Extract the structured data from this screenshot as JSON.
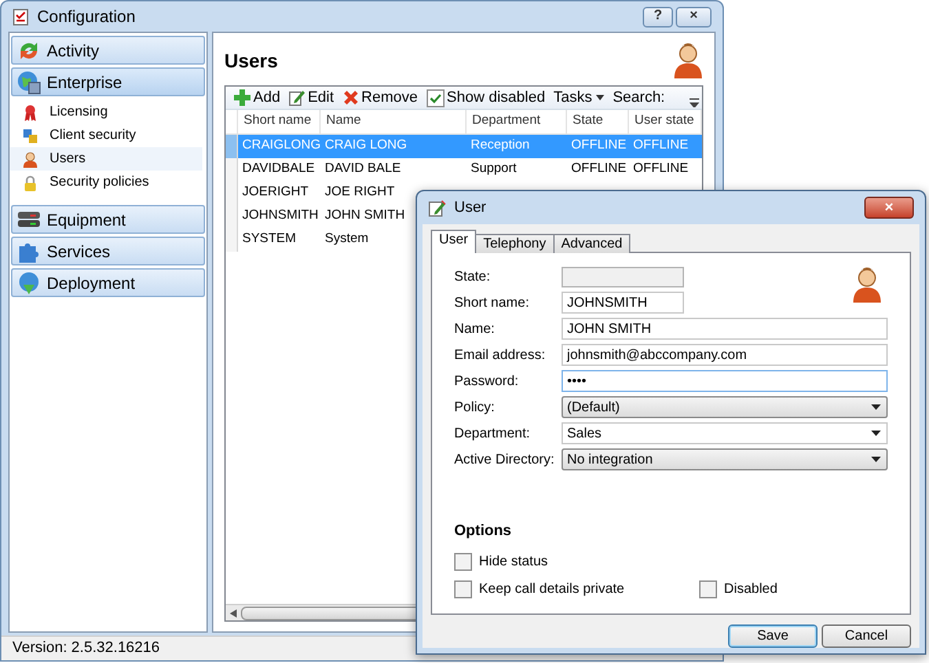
{
  "window": {
    "title": "Configuration",
    "buttons": [
      {
        "kind": "help",
        "label": "?"
      },
      {
        "kind": "close",
        "label": "×"
      }
    ]
  },
  "sidebar": {
    "groups": [
      {
        "label": "Activity",
        "expanded": false
      },
      {
        "label": "Enterprise",
        "expanded": true,
        "items": [
          {
            "label": "Licensing",
            "selected": false
          },
          {
            "label": "Client security",
            "selected": false
          },
          {
            "label": "Users",
            "selected": true
          },
          {
            "label": "Security policies",
            "selected": false
          }
        ]
      },
      {
        "label": "Equipment",
        "expanded": false
      },
      {
        "label": "Services",
        "expanded": false
      },
      {
        "label": "Deployment",
        "expanded": false
      }
    ]
  },
  "content": {
    "title": "Users",
    "toolbar": [
      {
        "kind": "add",
        "label": "Add"
      },
      {
        "kind": "edit",
        "label": "Edit"
      },
      {
        "kind": "remove",
        "label": "Remove"
      },
      {
        "kind": "checkbox",
        "label": "Show disabled",
        "checked": true
      },
      {
        "kind": "menu",
        "label": "Tasks"
      },
      {
        "kind": "label",
        "label": "Search:"
      }
    ],
    "table": {
      "columns": [
        "Short name",
        "Name",
        "Department",
        "State",
        "User state"
      ],
      "rows": [
        {
          "cells": [
            "CRAIGLONG",
            "CRAIG LONG",
            "Reception",
            "OFFLINE",
            "OFFLINE"
          ],
          "selected": true
        },
        {
          "cells": [
            "DAVIDBALE",
            "DAVID BALE",
            "Support",
            "OFFLINE",
            "OFFLINE"
          ],
          "selected": false
        },
        {
          "cells": [
            "JOERIGHT",
            "JOE RIGHT"
          ],
          "selected": false
        },
        {
          "cells": [
            "JOHNSMITH",
            "JOHN SMITH"
          ],
          "selected": false
        },
        {
          "cells": [
            "SYSTEM",
            "System"
          ],
          "selected": false
        }
      ]
    }
  },
  "status_bar": "Version: 2.5.32.16216",
  "dialog": {
    "title": "User",
    "close": "×",
    "tabs": [
      {
        "label": "User",
        "selected": true
      },
      {
        "label": "Telephony",
        "selected": false
      },
      {
        "label": "Advanced",
        "selected": false
      }
    ],
    "fields": [
      {
        "kind": "readonly",
        "label": "State:"
      },
      {
        "kind": "text",
        "label": "Short name:",
        "value": "JOHNSMITH"
      },
      {
        "kind": "text",
        "label": "Name:",
        "value": "JOHN SMITH"
      },
      {
        "kind": "text",
        "label": "Email address:",
        "value": "johnsmith@abccompany.com"
      },
      {
        "kind": "password",
        "label": "Password:",
        "value": "••••"
      },
      {
        "kind": "dropdown",
        "label": "Policy:",
        "value": "(Default)"
      },
      {
        "kind": "combo",
        "label": "Department:",
        "value": "Sales"
      },
      {
        "kind": "dropdown",
        "label": "Active Directory:",
        "value": "No integration"
      }
    ],
    "options": {
      "title": "Options",
      "checkboxes": [
        {
          "label": "Hide status",
          "checked": false
        },
        {
          "label": "Keep call details private",
          "checked": false
        },
        {
          "label": "Disabled",
          "checked": false
        }
      ]
    },
    "buttons": [
      {
        "label": "Save",
        "default": true
      },
      {
        "label": "Cancel",
        "default": false
      }
    ]
  }
}
